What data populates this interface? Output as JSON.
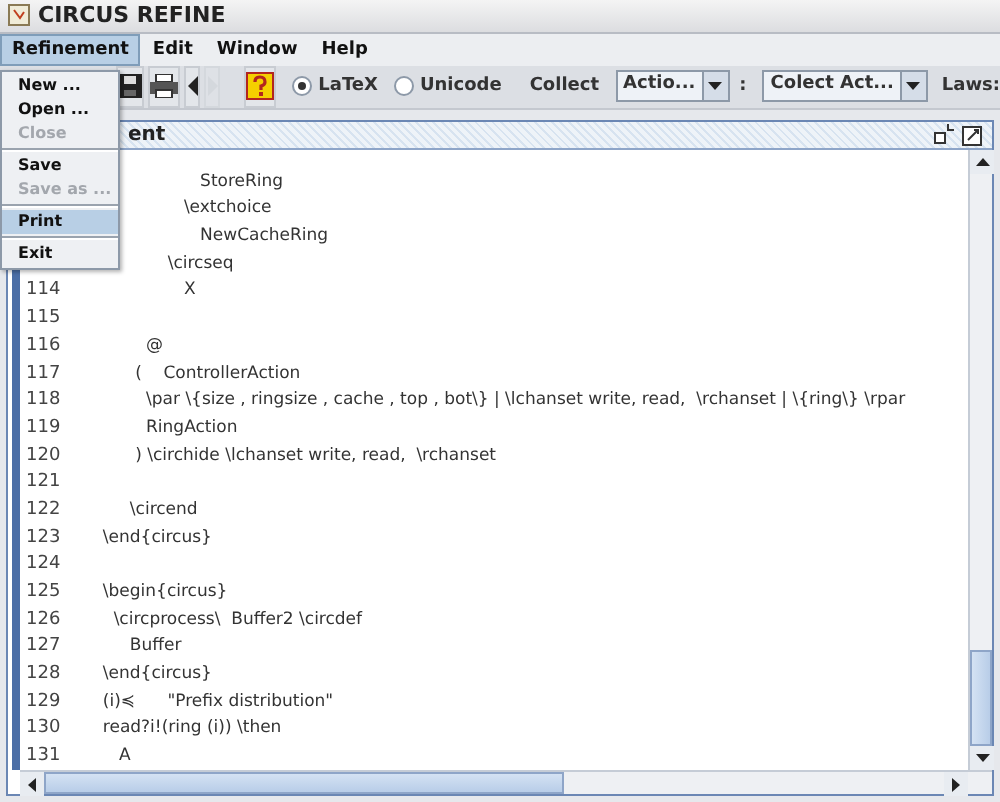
{
  "window": {
    "title": "CIRCUS REFINE"
  },
  "menubar": [
    {
      "label": "Refinement",
      "selected": true
    },
    {
      "label": "Edit",
      "selected": false
    },
    {
      "label": "Window",
      "selected": false
    },
    {
      "label": "Help",
      "selected": false
    }
  ],
  "menu": [
    {
      "kind": "item",
      "label": "New ...",
      "disabled": false,
      "selected": false
    },
    {
      "kind": "item",
      "label": "Open ...",
      "disabled": false,
      "selected": false
    },
    {
      "kind": "item",
      "label": "Close",
      "disabled": true,
      "selected": false
    },
    {
      "kind": "separator"
    },
    {
      "kind": "item",
      "label": "Save",
      "disabled": false,
      "selected": false
    },
    {
      "kind": "item",
      "label": "Save as ...",
      "disabled": true,
      "selected": false
    },
    {
      "kind": "separator"
    },
    {
      "kind": "item",
      "label": "Print",
      "disabled": false,
      "selected": true
    },
    {
      "kind": "separator"
    },
    {
      "kind": "item",
      "label": "Exit",
      "disabled": false,
      "selected": false
    }
  ],
  "toolbar": {
    "buttons": [
      {
        "kind": "save",
        "disabled": false
      },
      {
        "kind": "print",
        "disabled": false
      },
      {
        "kind": "back",
        "disabled": false
      },
      {
        "kind": "forward",
        "disabled": true
      },
      {
        "kind": "help",
        "disabled": false
      }
    ],
    "radios": [
      {
        "label": "LaTeX",
        "selected": true
      },
      {
        "label": "Unicode",
        "selected": false
      }
    ],
    "collect_label": "Collect",
    "combo_1": "Actio...",
    "colon": ":",
    "combo_2": "Colect Act...",
    "laws_label": "Laws:"
  },
  "document": {
    "title": "ent",
    "lines": [
      {
        "text": "                    StoreRing"
      },
      {
        "text": "                 \\extchoice"
      },
      {
        "text": "                    NewCacheRing"
      },
      {
        "text": "              \\circseq"
      },
      {
        "number": "114",
        "text": "                 X"
      },
      {
        "number": "115"
      },
      {
        "number": "116",
        "text": "          @"
      },
      {
        "number": "117",
        "text": "        (    ControllerAction"
      },
      {
        "number": "118",
        "text": "          \\par \\{size , ringsize , cache , top , bot\\} | \\lchanset write, read,  \\rchanset | \\{ring\\} \\rpar"
      },
      {
        "number": "119",
        "text": "          RingAction"
      },
      {
        "number": "120",
        "text": "        ) \\circhide \\lchanset write, read,  \\rchanset"
      },
      {
        "number": "121"
      },
      {
        "number": "122",
        "text": "       \\circend"
      },
      {
        "number": "123",
        "text": "  \\end{circus}"
      },
      {
        "number": "124"
      },
      {
        "number": "125",
        "text": "  \\begin{circus}"
      },
      {
        "number": "126",
        "text": "    \\circprocess\\  Buffer2 \\circdef"
      },
      {
        "number": "127",
        "text": "       Buffer"
      },
      {
        "number": "128",
        "text": "  \\end{circus}"
      },
      {
        "number": "129",
        "text": "  (i)≼      \"Prefix distribution\""
      },
      {
        "number": "130",
        "text": "  read?i!(ring (i)) \\then"
      },
      {
        "number": "131",
        "text": "     A"
      }
    ]
  }
}
